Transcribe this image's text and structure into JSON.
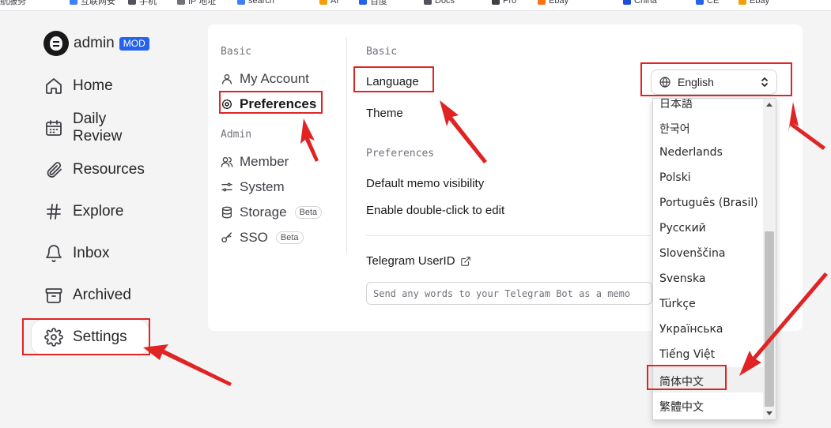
{
  "bookmarks": [
    {
      "label": "航服务",
      "color": "#9ca3af"
    },
    {
      "label": "互联网安",
      "color": "#3b82f6"
    },
    {
      "label": "手机",
      "color": "#52525b"
    },
    {
      "label": "IP 地址",
      "color": "#71717a"
    },
    {
      "label": "search",
      "color": "#3b82f6"
    },
    {
      "label": "AI",
      "color": "#f59e0b"
    },
    {
      "label": "百度",
      "color": "#2563eb"
    },
    {
      "label": "Docs",
      "color": "#52525b"
    },
    {
      "label": "Pro",
      "color": "#3f3f46"
    },
    {
      "label": "Ebay",
      "color": "#f97316"
    },
    {
      "label": "China",
      "color": "#1d4ed8"
    },
    {
      "label": "CE",
      "color": "#2563eb"
    },
    {
      "label": "Ebay",
      "color": "#f59e0b"
    }
  ],
  "user": {
    "name": "admin",
    "badge": "MOD"
  },
  "nav": [
    {
      "label": "Home",
      "icon": "home-icon"
    },
    {
      "label": "Daily Review",
      "icon": "calendar-icon"
    },
    {
      "label": "Resources",
      "icon": "paperclip-icon"
    },
    {
      "label": "Explore",
      "icon": "hash-icon"
    },
    {
      "label": "Inbox",
      "icon": "bell-icon"
    },
    {
      "label": "Archived",
      "icon": "archive-icon"
    },
    {
      "label": "Settings",
      "icon": "gear-icon",
      "active": true
    }
  ],
  "settings_menu": {
    "basic_title": "Basic",
    "basic_items": [
      {
        "label": "My Account",
        "icon": "user-icon"
      },
      {
        "label": "Preferences",
        "icon": "gear-icon",
        "active": true
      }
    ],
    "admin_title": "Admin",
    "admin_items": [
      {
        "label": "Member",
        "icon": "users-icon"
      },
      {
        "label": "System",
        "icon": "sliders-icon"
      },
      {
        "label": "Storage",
        "icon": "database-icon",
        "badge": "Beta"
      },
      {
        "label": "SSO",
        "icon": "key-icon",
        "badge": "Beta"
      }
    ]
  },
  "preferences": {
    "basic_title": "Basic",
    "language_label": "Language",
    "theme_label": "Theme",
    "prefs_title": "Preferences",
    "visibility_label": "Default memo visibility",
    "dblclick_label": "Enable double-click to edit",
    "telegram_label": "Telegram UserID",
    "telegram_placeholder": "Send any words to your Telegram Bot as a memo"
  },
  "language_select": {
    "selected": "English",
    "options": [
      "日本語",
      "한국어",
      "Nederlands",
      "Polski",
      "Português (Brasil)",
      "Русский",
      "Slovenščina",
      "Svenska",
      "Türkçe",
      "Українська",
      "Tiếng Việt",
      "简体中文",
      "繁體中文"
    ],
    "highlighted": "简体中文"
  },
  "colors": {
    "accent": "#2563eb",
    "annotation": "#e02424"
  }
}
